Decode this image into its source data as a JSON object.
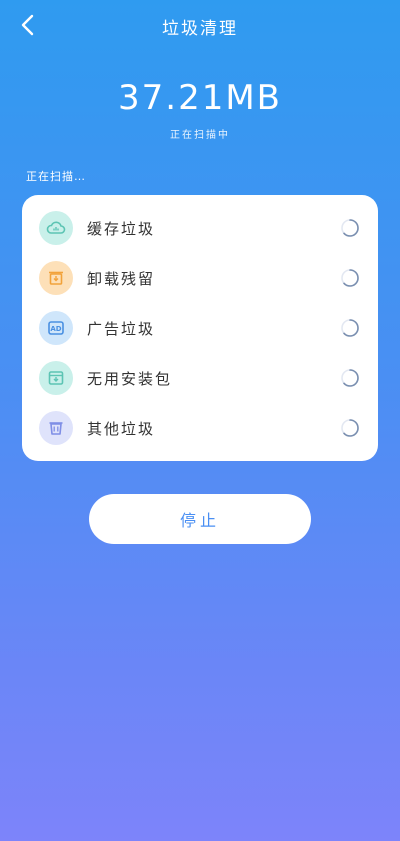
{
  "header": {
    "title": "垃圾清理",
    "back_icon": "back-arrow-icon"
  },
  "summary": {
    "size": "37.21MB",
    "status": "正在扫描中"
  },
  "scan_label": "正在扫描…",
  "items": [
    {
      "label": "缓存垃圾",
      "icon": "cloud-icon",
      "icon_bg": "#c9f0ea",
      "icon_color": "#5cc4b3"
    },
    {
      "label": "卸载残留",
      "icon": "uninstall-icon",
      "icon_bg": "#fde0b8",
      "icon_color": "#f2a23a"
    },
    {
      "label": "广告垃圾",
      "icon": "ad-icon",
      "icon_bg": "#cfe6fb",
      "icon_color": "#4a90e2"
    },
    {
      "label": "无用安装包",
      "icon": "package-icon",
      "icon_bg": "#c9f0ea",
      "icon_color": "#5cc4b3"
    },
    {
      "label": "其他垃圾",
      "icon": "trash-icon",
      "icon_bg": "#dfe3fb",
      "icon_color": "#7f8ee6"
    }
  ],
  "stop_button": {
    "label": "停止"
  },
  "colors": {
    "accent": "#4a8ff3",
    "gradient_top": "#2f9bf0",
    "gradient_bottom": "#7d84fa"
  }
}
